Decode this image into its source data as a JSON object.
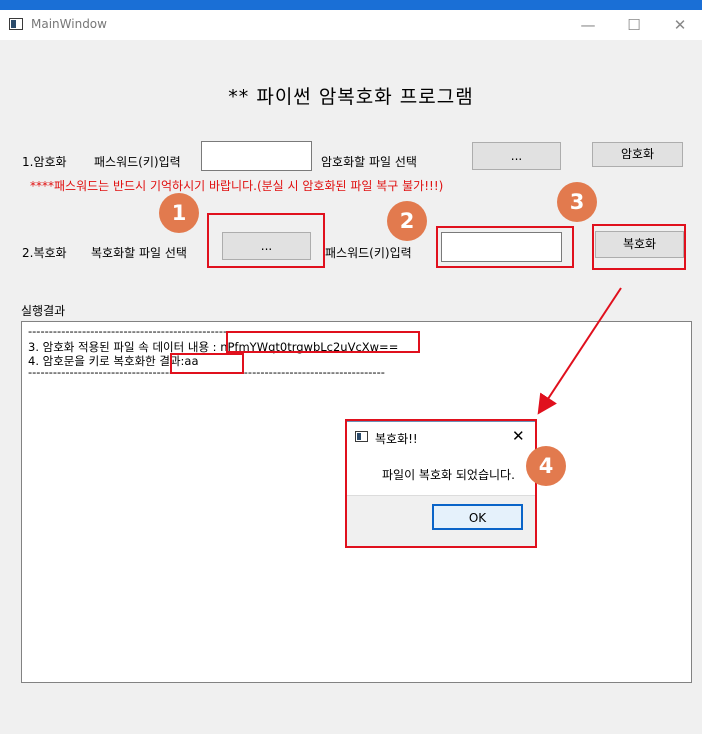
{
  "window": {
    "title": "MainWindow",
    "minimize": "—",
    "maximize": "☐",
    "close": "✕"
  },
  "heading": "** 파이썬 암복호화 프로그램",
  "encrypt": {
    "section_label": "1.암호화",
    "password_label": "패스워드(키)입력",
    "password_value": "",
    "file_label": "암호화할 파일 선택",
    "browse_label": "...",
    "action_label": "암호화",
    "warning": "****패스워드는 반드시 기억하시기 바랍니다.(분실 시 암호화된 파일 복구 불가!!!)"
  },
  "decrypt": {
    "section_label": "2.복호화",
    "file_label": "복호화할 파일 선택",
    "browse_label": "...",
    "password_label": "패스워드(키)입력",
    "password_value": "",
    "action_label": "복호화"
  },
  "result": {
    "label": "실행결과",
    "lines": [
      "--------------------------------------------------------------------------------------",
      "3. 암호화 적용된 파일 속 데이터 내용 : nPfmYWqt0trgwbLc2uVcXw==",
      "4. 암호문을 키로 복호화한 결과:aa",
      "--------------------------------------------------------------------------------------"
    ]
  },
  "dialog": {
    "title": "복호화!!",
    "close": "✕",
    "message": "파일이 복호화 되었습니다.",
    "ok_label": "OK"
  },
  "annotations": {
    "markers": [
      "1",
      "2",
      "3",
      "4"
    ],
    "color": "#e0101d",
    "marker_color": "#e27a4e"
  }
}
